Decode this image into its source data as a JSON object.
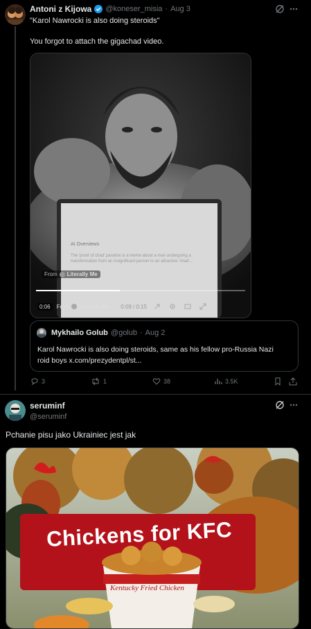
{
  "tweet1": {
    "author_name": "Antoni z Kijowa",
    "handle": "@koneser_misia",
    "separator": "·",
    "date": "Aug 3",
    "text_line1": "\"Karol Nawrocki is also doing steroids\"",
    "text_line2": "You forgot to attach the gigachad video.",
    "video": {
      "from_overlay": "From",
      "from_source": "Literally Me",
      "time_current": "0:06",
      "time_total": "0:09 / 0:15",
      "controls_from": "From",
      "controls_source": "Literally Me",
      "screen_heading": "AI Overviews",
      "screen_text": "The 'proof of chad' paradox is a meme about a man undergoing a transformation from an insignificant person to an attractive 'chad'..."
    },
    "quote": {
      "author_name": "Mykhailo Golub",
      "handle": "@golub",
      "separator": "·",
      "date": "Aug 2",
      "text_line1": "Karol Nawrocki is also doing steroids, same as his fellow pro-Russia Nazi",
      "text_line2": "roid boys x.com/prezydentpl/st..."
    },
    "actions": {
      "replies": "3",
      "reposts": "1",
      "likes": "38",
      "views": "3.5K"
    }
  },
  "tweet2": {
    "author_name": "seruminf",
    "handle": "@seruminf",
    "text": "Pchanie pisu jako Ukrainiec jest jak",
    "image": {
      "banner_text": "Chickens for KFC",
      "bucket_text": "Kentucky Fried Chicken"
    }
  },
  "colors": {
    "background": "#000000",
    "text": "#e7e9ea",
    "muted": "#71767b",
    "border": "#2f3336",
    "verified": "#1d9bf0",
    "banner": "#b3121b"
  }
}
